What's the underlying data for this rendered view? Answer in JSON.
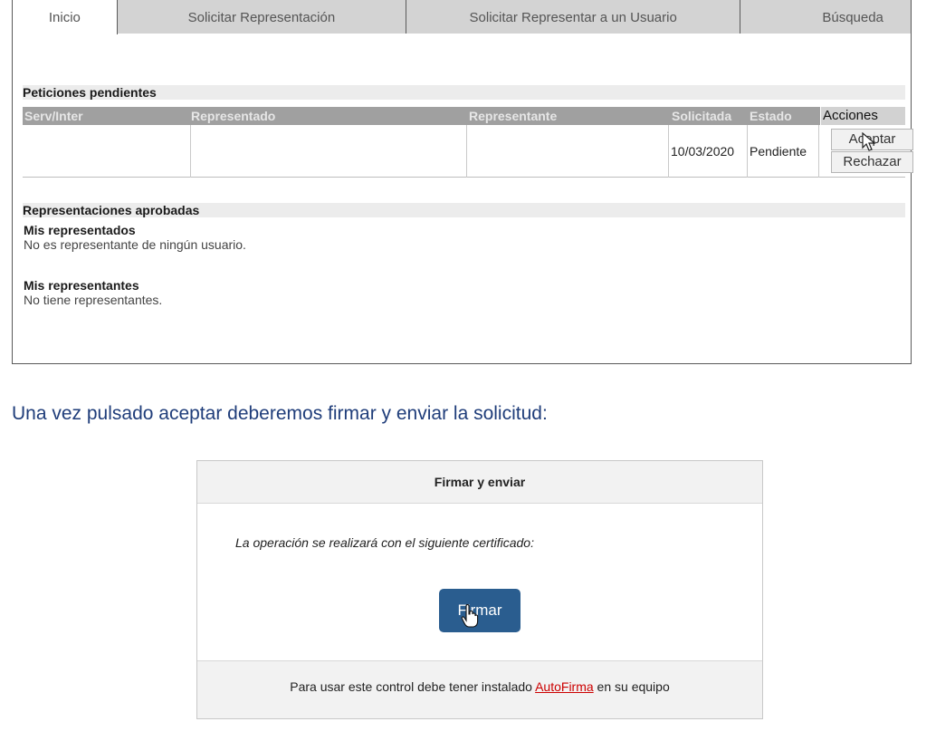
{
  "tabs": [
    {
      "label": "Inicio",
      "active": true
    },
    {
      "label": "Solicitar Representación",
      "active": false
    },
    {
      "label": "Solicitar Representar a un Usuario",
      "active": false
    },
    {
      "label": "Búsqueda",
      "active": false
    }
  ],
  "pending": {
    "title": "Peticiones pendientes",
    "columns": [
      "Serv/Inter",
      "Representado",
      "Representante",
      "Solicitada",
      "Estado",
      "Acciones"
    ],
    "row": {
      "serv_inter": "",
      "representado": "",
      "representante": "",
      "solicitada": "10/03/2020",
      "estado": "Pendiente",
      "accept_label": "Aceptar",
      "reject_label": "Rechazar"
    }
  },
  "approved": {
    "title": "Representaciones aprobadas",
    "represented_title": "Mis representados",
    "represented_text": "No es representante de ningún usuario.",
    "representatives_title": "Mis representantes",
    "representatives_text": "No tiene representantes."
  },
  "instruction": "Una vez pulsado aceptar deberemos firmar y enviar la solicitud:",
  "dialog": {
    "title": "Firmar y enviar",
    "message": "La operación se realizará con el siguiente certificado: ",
    "sign_label": "Firmar",
    "footer_before": "Para usar este control debe tener instalado ",
    "footer_link": "AutoFirma",
    "footer_after": " en su equipo",
    "accent_color": "#2a5d8f",
    "link_color": "#cc0000"
  },
  "icons": [
    "arrow-cursor-icon",
    "hand-cursor-icon"
  ]
}
